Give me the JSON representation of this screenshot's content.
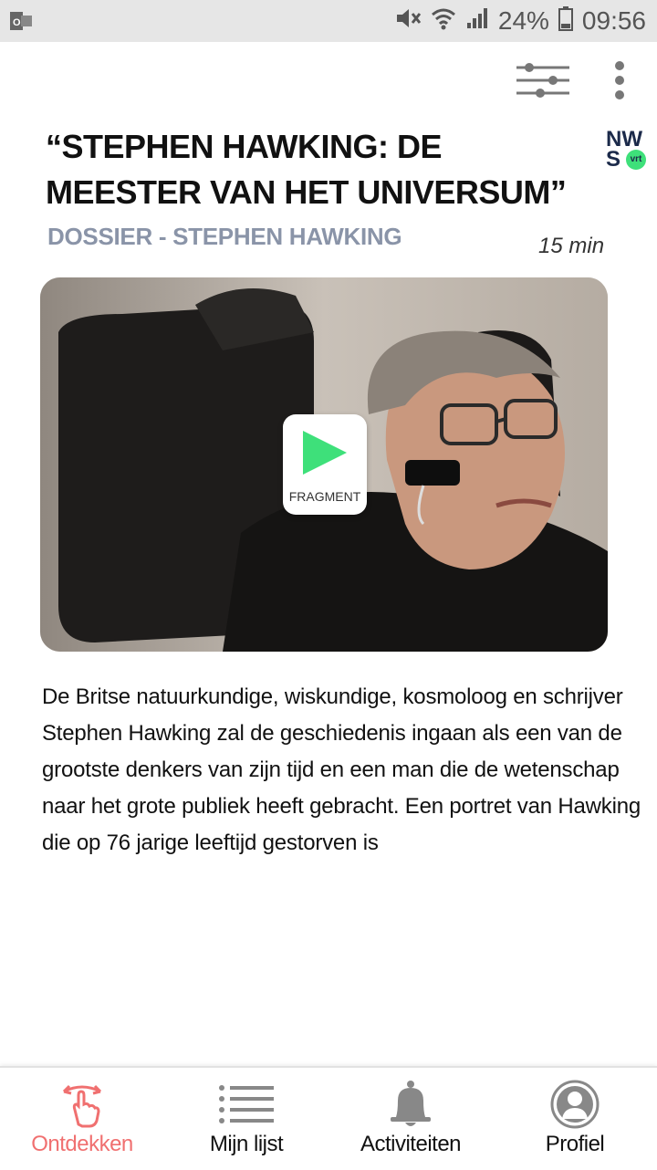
{
  "status_bar": {
    "battery": "24%",
    "time": "09:56",
    "icons": [
      "outlook-icon",
      "mute-icon",
      "wifi-icon",
      "signal-icon",
      "battery-icon"
    ]
  },
  "toolbar": {
    "icons": [
      "filter-icon",
      "more-vertical-icon"
    ]
  },
  "article": {
    "title": "“STEPHEN HAWKING: DE MEESTER VAN HET UNIVERSUM”",
    "source_logo": {
      "line1": "NW",
      "line2": "S",
      "badge": "vrt"
    },
    "dossier": "DOSSIER - STEPHEN HAWKING",
    "duration": "15 min",
    "media": {
      "play_label": "FRAGMENT",
      "image": "portrait of a man with glasses in a wheelchair"
    },
    "description": "De Britse natuurkundige, wiskundige, kosmoloog en schrijver Stephen Hawking zal de geschiedenis ingaan als een van de grootste denkers van zijn tijd en een man die de wetenschap naar het grote publiek heeft gebracht. Een portret van Hawking die op 76 jarige leeftijd gestorven is"
  },
  "bottom_nav": {
    "items": [
      {
        "label": "Ontdekken",
        "icon": "swipe-hand-icon",
        "active": true
      },
      {
        "label": "Mijn lijst",
        "icon": "list-icon",
        "active": false
      },
      {
        "label": "Activiteiten",
        "icon": "bell-icon",
        "active": false
      },
      {
        "label": "Profiel",
        "icon": "profile-icon",
        "active": false
      }
    ]
  },
  "colors": {
    "accent_green": "#3ee07a",
    "active_nav": "#f07070",
    "dossier_gray": "#8a94a8"
  }
}
